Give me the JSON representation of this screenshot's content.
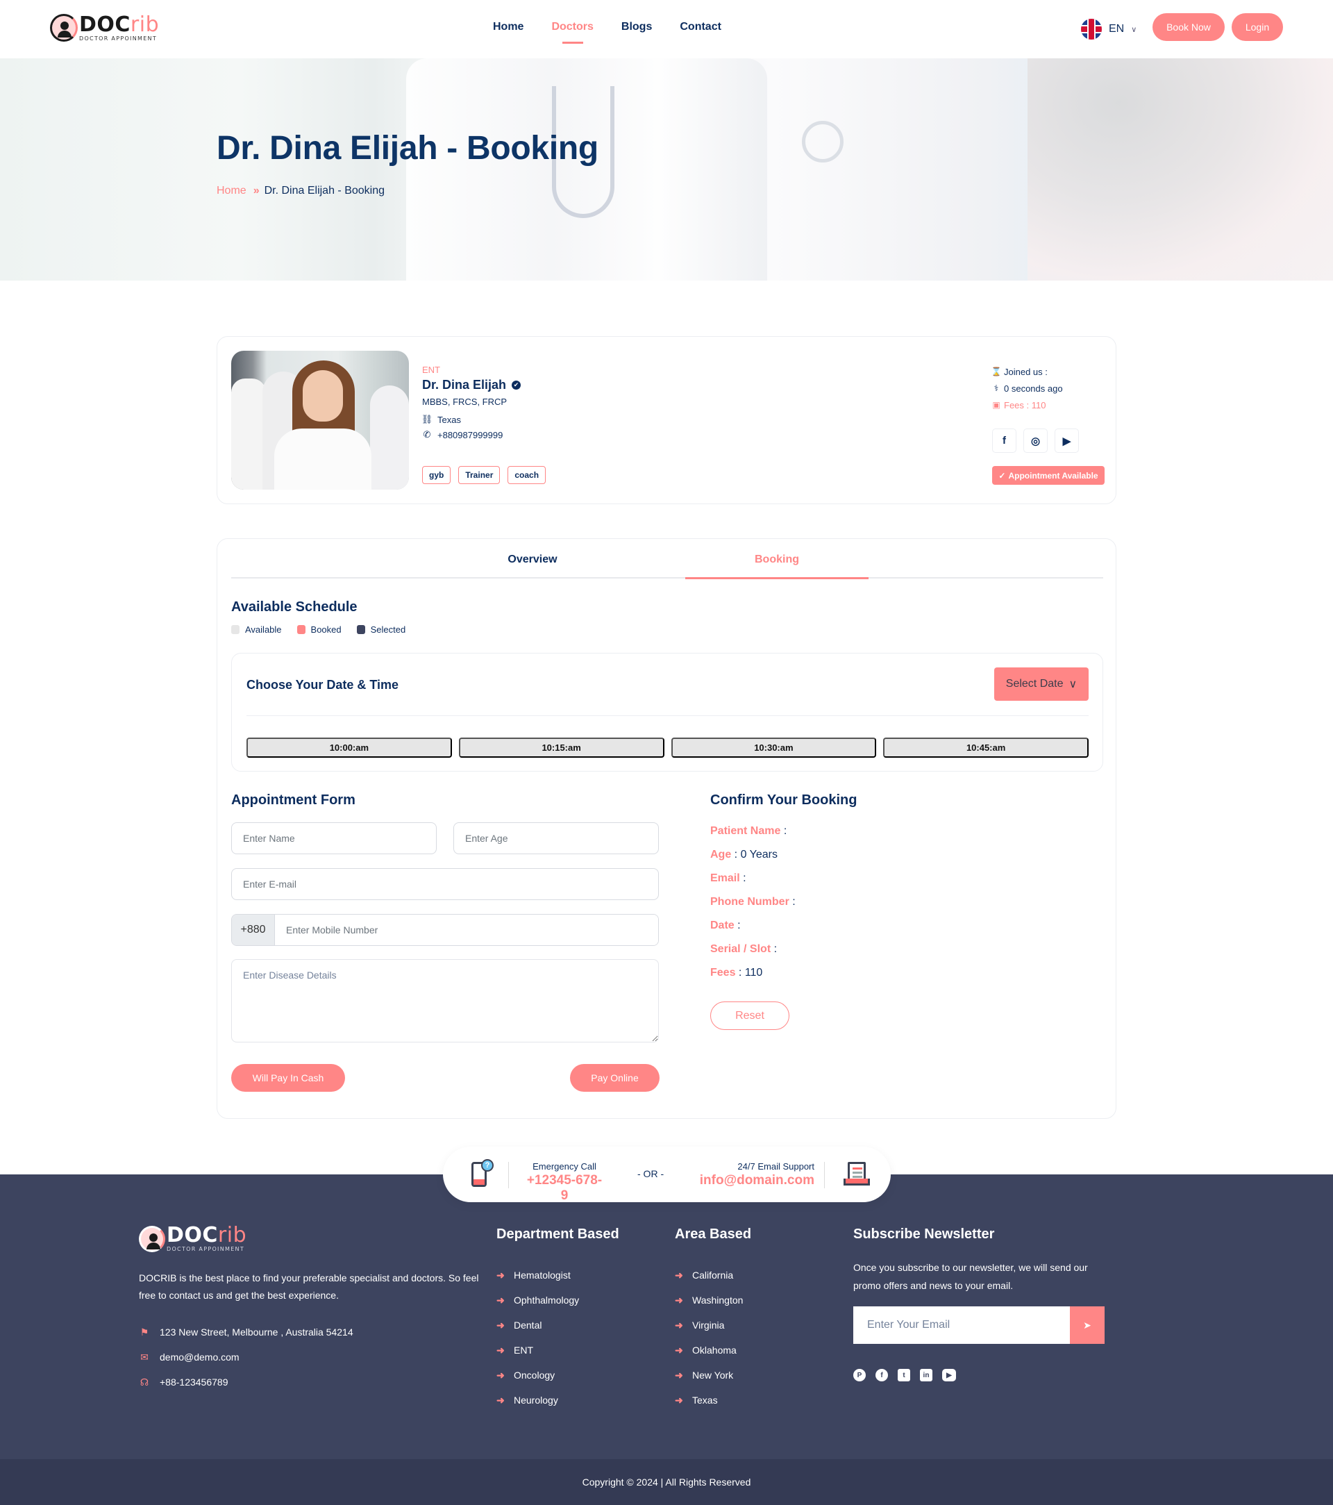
{
  "header": {
    "logo": {
      "word_main": "DOC",
      "word_accent": "rib",
      "tagline": "DOCTOR APPOINMENT"
    },
    "nav": [
      {
        "label": "Home",
        "active": false
      },
      {
        "label": "Doctors",
        "active": true
      },
      {
        "label": "Blogs",
        "active": false
      },
      {
        "label": "Contact",
        "active": false
      }
    ],
    "language": {
      "flag_icon": "uk-flag-icon",
      "code": "EN",
      "caret": "∨"
    },
    "book_now_label": "Book Now",
    "login_label": "Login"
  },
  "hero": {
    "title": "Dr. Dina Elijah - Booking",
    "breadcrumb": {
      "home": "Home",
      "separator": "»",
      "current": "Dr. Dina Elijah - Booking"
    }
  },
  "doctor": {
    "department": "ENT",
    "name": "Dr. Dina Elijah",
    "verified_icon": "✔",
    "degrees": "MBBS, FRCS, FRCP",
    "location": "Texas",
    "phone": "+880987999999",
    "tags": [
      "gyb",
      "Trainer",
      "coach"
    ],
    "joined_label": "Joined us :",
    "joined_ago": "0 seconds ago",
    "fees_label": "Fees : 110",
    "socials": [
      {
        "name": "facebook",
        "glyph": "f"
      },
      {
        "name": "instagram",
        "glyph": "◎"
      },
      {
        "name": "youtube",
        "glyph": "▶"
      }
    ],
    "availability_badge": "Appointment Available",
    "availability_icon": "✓"
  },
  "booking": {
    "tabs": [
      {
        "label": "Overview",
        "active": false
      },
      {
        "label": "Booking",
        "active": true
      }
    ],
    "schedule_title": "Available Schedule",
    "legend": [
      {
        "label": "Available",
        "color": "#e6e6e6"
      },
      {
        "label": "Booked",
        "color": "#ff8686"
      },
      {
        "label": "Selected",
        "color": "#3d445f"
      }
    ],
    "date_title": "Choose Your Date & Time",
    "select_date_label": "Select Date",
    "select_date_caret": "∨",
    "slots": [
      "10:00:am",
      "10:15:am",
      "10:30:am",
      "10:45:am"
    ],
    "form": {
      "title": "Appointment Form",
      "name_placeholder": "Enter Name",
      "age_placeholder": "Enter Age",
      "email_placeholder": "Enter E-mail",
      "phone_prefix": "+880",
      "phone_placeholder": "Enter Mobile Number",
      "disease_placeholder": "Enter Disease Details",
      "pay_cash_label": "Will Pay In Cash",
      "pay_online_label": "Pay Online"
    },
    "confirm": {
      "title": "Confirm Your Booking",
      "rows": [
        {
          "label": "Patient Name",
          "value": ""
        },
        {
          "label": "Age",
          "value": "0 Years"
        },
        {
          "label": "Email",
          "value": ""
        },
        {
          "label": "Phone Number",
          "value": ""
        },
        {
          "label": "Date",
          "value": ""
        },
        {
          "label": "Serial / Slot",
          "value": ""
        },
        {
          "label": "Fees",
          "value": "110"
        }
      ],
      "reset_label": "Reset"
    }
  },
  "contact_strip": {
    "call_label": "Emergency Call",
    "call_value": "+12345-678-9",
    "or_text": "- OR -",
    "mail_label": "24/7 Email Support",
    "mail_value": "info@domain.com"
  },
  "footer": {
    "logo": {
      "word_main": "DOC",
      "word_accent": "rib",
      "tagline": "DOCTOR APPOINMENT"
    },
    "about": "DOCRIB is the best place to find your preferable specialist and doctors. So feel free to contact us and get the best experience.",
    "address": "123 New Street, Melbourne , Australia 54214",
    "email": "demo@demo.com",
    "phone": "+88-123456789",
    "department_title": "Department Based",
    "departments": [
      "Hematologist",
      "Ophthalmology",
      "Dental",
      "ENT",
      "Oncology",
      "Neurology"
    ],
    "area_title": "Area Based",
    "areas": [
      "California",
      "Washington",
      "Virginia",
      "Oklahoma",
      "New York",
      "Texas"
    ],
    "newsletter_title": "Subscribe Newsletter",
    "newsletter_text": "Once you subscribe to our newsletter, we will send our promo offers and news to your email.",
    "newsletter_placeholder": "Enter Your Email",
    "send_icon": "➤",
    "socials": [
      "pinterest",
      "facebook",
      "twitter",
      "linkedin",
      "youtube"
    ],
    "copyright": "Copyright © 2024 | All Rights Reserved"
  }
}
